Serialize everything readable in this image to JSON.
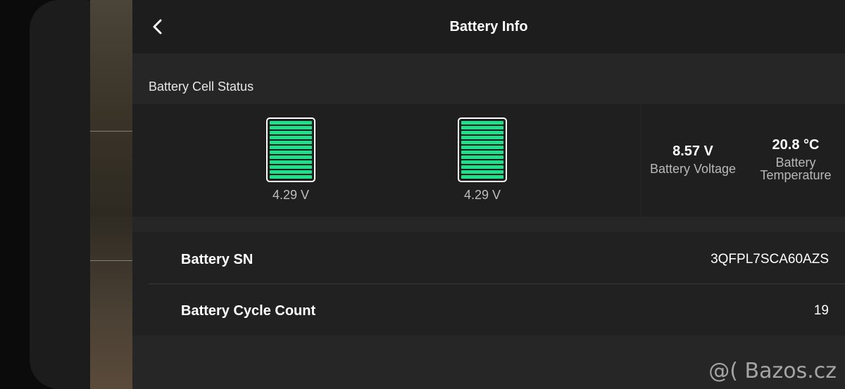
{
  "header": {
    "title": "Battery Info"
  },
  "cell_status": {
    "title": "Battery Cell Status",
    "cells": [
      {
        "voltage": "4.29 V"
      },
      {
        "voltage": "4.29 V"
      }
    ]
  },
  "stats": {
    "voltage": {
      "value": "8.57 V",
      "label": "Battery Voltage"
    },
    "temperature": {
      "value": "20.8 °C",
      "label_line1": "Battery",
      "label_line2": "Temperature"
    }
  },
  "info": {
    "serial": {
      "label": "Battery SN",
      "value": "3QFPL7SCA60AZS"
    },
    "cycles": {
      "label": "Battery Cycle Count",
      "value": "19"
    }
  },
  "watermark": "@( Bazos.cz",
  "colors": {
    "cell_fill": "#1fe08a",
    "panel": "#262626",
    "header": "#1d1d1d"
  },
  "icons": {
    "back": "chevron-left-icon"
  }
}
